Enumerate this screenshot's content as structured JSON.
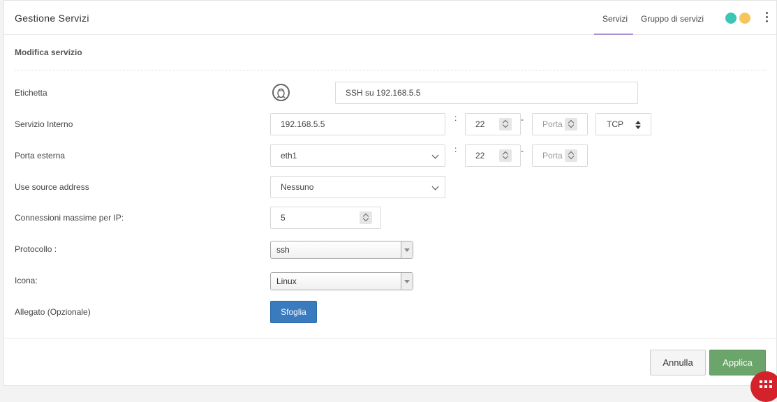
{
  "header": {
    "title": "Gestione Servizi",
    "tabs": [
      {
        "label": "Servizi",
        "active": true
      },
      {
        "label": "Gruppo di servizi",
        "active": false
      }
    ],
    "status_colors": [
      "#3cc6b6",
      "#f7c65a"
    ],
    "menu_icon": "kebab-menu-icon"
  },
  "form": {
    "title": "Modifica servizio",
    "label_field": {
      "label": "Etichetta",
      "icon": "linux-tux-icon",
      "value": "SSH su 192.168.5.5"
    },
    "internal_service": {
      "label": "Servizio Interno",
      "ip": "192.168.5.5",
      "port": "22",
      "port_end_placeholder": "Porta",
      "protocol": "TCP"
    },
    "external_port": {
      "label": "Porta esterna",
      "interface": "eth1",
      "port": "22",
      "port_end_placeholder": "Porta"
    },
    "source_address": {
      "label": "Use source address",
      "value": "Nessuno"
    },
    "max_connections": {
      "label": "Connessioni massime per IP:",
      "value": "5"
    },
    "protocol": {
      "label": "Protocollo :",
      "value": "ssh"
    },
    "icon": {
      "label": "Icona:",
      "value": "Linux"
    },
    "attachment": {
      "label": "Allegato (Opzionale)",
      "button": "Sfoglia"
    },
    "separator_colon": ":",
    "separator_dash": "-"
  },
  "footer": {
    "cancel": "Annulla",
    "apply": "Applica"
  },
  "colors": {
    "accent_tab": "#7e57c2",
    "browse_button": "#3a7bbf",
    "apply_button": "#6ba56b",
    "fab": "#d3222a"
  }
}
